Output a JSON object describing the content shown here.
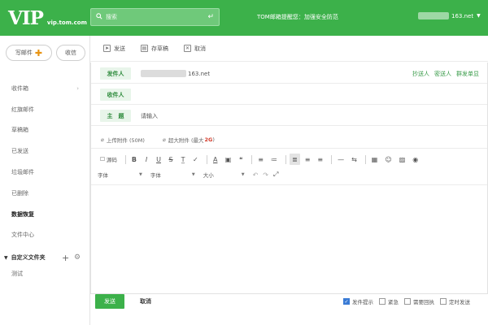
{
  "header": {
    "logo": "VIP",
    "domain": "vip.tom.com",
    "search_placeholder": "搜索",
    "promo": "TOM邮箱提醒您：加强安全防范",
    "account_suffix": "163.net",
    "accent_color": "#3cb14a"
  },
  "sidebar": {
    "compose_label": "写邮件",
    "receive_label": "收信",
    "items": [
      {
        "label": "收件箱",
        "icon": "chevron-right-icon"
      },
      {
        "label": "红旗邮件"
      },
      {
        "label": "草稿箱"
      },
      {
        "label": "已发送"
      },
      {
        "label": "垃圾邮件"
      },
      {
        "label": "已删除"
      },
      {
        "label": "数据恢复"
      },
      {
        "label": "文件中心"
      }
    ],
    "custom_folder_label": "自定义文件夹",
    "custom_folder_items": [
      "测试"
    ]
  },
  "toolbar": {
    "buttons": [
      {
        "label": "发送",
        "icon": "send-icon"
      },
      {
        "label": "存草稿",
        "icon": "draft-icon"
      },
      {
        "label": "取消",
        "icon": "cancel-icon"
      }
    ]
  },
  "compose": {
    "from_label": "发件人",
    "from_value": "163.net",
    "to_label": "收件人",
    "to_value": "",
    "subject_label": "主　题",
    "subject_placeholder": "请输入",
    "header_actions": [
      "抄送人",
      "密送人",
      "群发单显"
    ],
    "attach_label": "上传附件 (50M)",
    "big_attach_label": "超大附件 (最大",
    "big_attach_size": "2G",
    "big_attach_close": ")"
  },
  "editor": {
    "source_label": "源码",
    "buttons": [
      "B",
      "I",
      "U",
      "S",
      "T̲",
      "✓",
      "A",
      "▣",
      "❝",
      "≡",
      "≔",
      "≣",
      "≡",
      "≡",
      "—",
      "⇆",
      "▦",
      "☺",
      "▨",
      "◉"
    ],
    "font_label": "字体",
    "style_label": "字体",
    "size_label": "大小"
  },
  "footer": {
    "send_label": "发送",
    "cancel_label": "取消",
    "options": [
      {
        "label": "发件提示",
        "checked": true
      },
      {
        "label": "紧急",
        "checked": false
      },
      {
        "label": "需要回执",
        "checked": false
      },
      {
        "label": "定时发送",
        "checked": false
      }
    ]
  }
}
